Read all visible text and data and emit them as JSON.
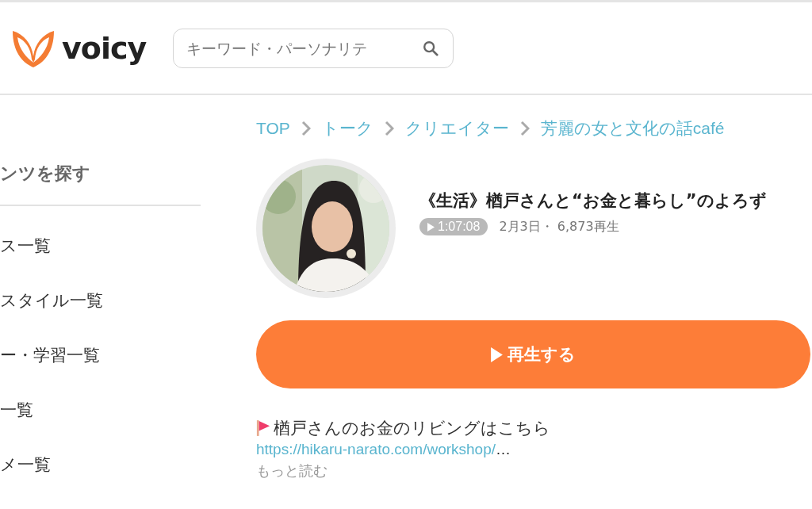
{
  "header": {
    "logo": "voicy",
    "search": {
      "placeholder": "キーワード・パーソナリテ"
    }
  },
  "sidebar": {
    "heading": "ンツを探す",
    "items": [
      {
        "label": "ス一覧"
      },
      {
        "label": "スタイル一覧"
      },
      {
        "label": "ー・学習一覧"
      },
      {
        "label": "一覧"
      },
      {
        "label": "メ一覧"
      }
    ]
  },
  "breadcrumb": [
    "TOP",
    "トーク",
    "クリエイター",
    "芳麗の女と文化の話café"
  ],
  "episode": {
    "title": "《生活》楢戸さんと“お金と暮らし”のよろず",
    "duration": "1:07:08",
    "meta": "2月3日・ 6,873再生",
    "play_button": "再生する",
    "description": "楢戸さんのお金のリビングはこちら",
    "link": "https://hikaru-narato.com/workshop/",
    "ellipsis": "…",
    "more": "もっと読む"
  }
}
